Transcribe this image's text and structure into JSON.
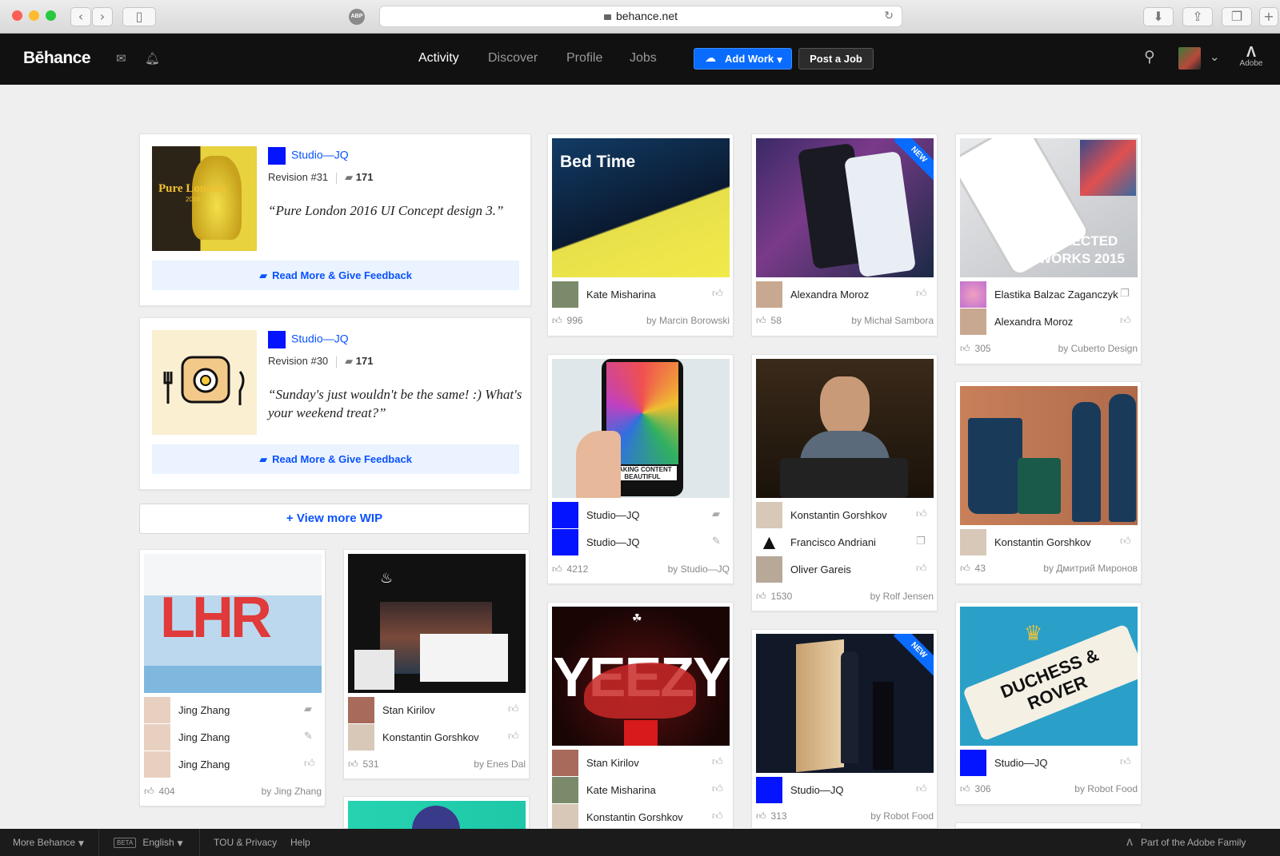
{
  "browser": {
    "url": "behance.net",
    "abp": "ABP",
    "back": "‹",
    "forward": "›"
  },
  "header": {
    "logo": "Bēhance",
    "nav": [
      "Activity",
      "Discover",
      "Profile",
      "Jobs"
    ],
    "add_work": "Add Work",
    "post_job": "Post a Job",
    "adobe": "Adobe"
  },
  "wip": [
    {
      "studio": "Studio—JQ",
      "revision": "Revision #31",
      "comments": "171",
      "quote": "“Pure London 2016 UI Concept design 3.”",
      "thumb_text": "Pure London",
      "thumb_sub": "2016",
      "button": "Read More & Give Feedback"
    },
    {
      "studio": "Studio—JQ",
      "revision": "Revision #30",
      "comments": "171",
      "quote": "“Sunday's just wouldn't be the same! :) What's your weekend treat?”",
      "button": "Read More & Give Feedback"
    }
  ],
  "view_more": "+ View more WIP",
  "projects": {
    "bedtime": {
      "title": "Bed Time",
      "users": [
        "Kate Misharina"
      ],
      "likes": "996",
      "by": "by  Marcin Borowski"
    },
    "mobile_ui": {
      "users": [
        "Alexandra Moroz"
      ],
      "likes": "58",
      "by": "by  Michał Sambora",
      "badge": "NEW"
    },
    "selected": {
      "title": "SELECTED WORKS 2015",
      "users": [
        "Elastika Balzac Zaganczyk",
        "Alexandra Moroz"
      ],
      "likes": "305",
      "by": "by  Cuberto Design"
    },
    "making": {
      "title": "MAKING CONTENT BEAUTIFUL",
      "users": [
        "Studio—JQ",
        "Studio—JQ"
      ],
      "likes": "4212",
      "by": "by  Studio—JQ"
    },
    "trumbo": {
      "users": [
        "Konstantin Gorshkov",
        "Francisco Andriani",
        "Oliver Gareis"
      ],
      "likes": "1530",
      "by": "by  Rolf Jensen"
    },
    "cups": {
      "users": [
        "Konstantin Gorshkov"
      ],
      "likes": "43",
      "by": "by  Дмитрий Миронов"
    },
    "lhr": {
      "title": "LHR",
      "users": [
        "Jing Zhang",
        "Jing Zhang",
        "Jing Zhang"
      ],
      "likes": "404",
      "by": "by  Jing Zhang"
    },
    "dark_web": {
      "users": [
        "Stan Kirilov",
        "Konstantin Gorshkov"
      ],
      "likes": "531",
      "by": "by  Enes Dal"
    },
    "yeezy": {
      "title": "YEEZY",
      "users": [
        "Stan Kirilov",
        "Kate Misharina",
        "Konstantin Gorshkov"
      ]
    },
    "wine": {
      "users": [
        "Studio—JQ"
      ],
      "likes": "313",
      "by": "by  Robot Food",
      "badge": "NEW"
    },
    "duchess": {
      "title": "DUCHESS & ROVER",
      "users": [
        "Studio—JQ"
      ],
      "likes": "306",
      "by": "by  Robot Food"
    }
  },
  "footer": {
    "more": "More Behance",
    "beta": "BETA",
    "lang": "English",
    "tou": "TOU & Privacy",
    "help": "Help",
    "adobe_family": "Part of the Adobe Family"
  }
}
